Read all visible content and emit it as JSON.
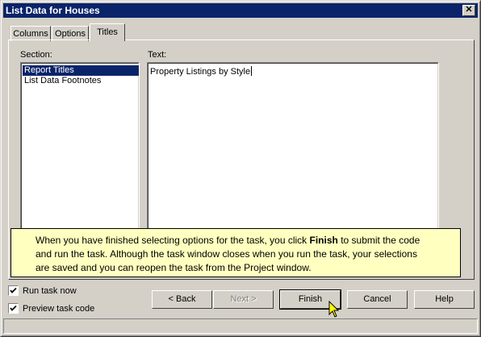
{
  "window": {
    "title": "List Data for Houses",
    "close_icon": "close-icon"
  },
  "tabs": [
    {
      "label": "Columns",
      "active": false
    },
    {
      "label": "Options",
      "active": false
    },
    {
      "label": "Titles",
      "active": true
    }
  ],
  "section": {
    "label": "Section:",
    "items": [
      {
        "label": "Report Titles",
        "selected": true
      },
      {
        "label": "List Data Footnotes",
        "selected": false
      }
    ]
  },
  "text_field": {
    "label": "Text:",
    "value": "Property Listings by Style"
  },
  "tip": {
    "line1_before": "When you have finished selecting options for the task, you click ",
    "line1_bold": "Finish",
    "line1_after": " to submit the code",
    "line2": "and run the task.  Although the task window closes when you run the task, your selections",
    "line3": "are saved and you can reopen the task from the Project window."
  },
  "options": {
    "run_task_now": {
      "label": "Run task now",
      "checked": true
    },
    "preview_task_code": {
      "label": "Preview task code",
      "checked": true
    }
  },
  "buttons": {
    "back": {
      "label": "< Back",
      "enabled": true
    },
    "next": {
      "label": "Next >",
      "enabled": false
    },
    "finish": {
      "label": "Finish",
      "enabled": true
    },
    "cancel": {
      "label": "Cancel",
      "enabled": true
    },
    "help": {
      "label": "Help",
      "enabled": true
    }
  },
  "colors": {
    "titlebar": "#0a246a",
    "face": "#d4d0c8",
    "tip_background": "#ffffc0",
    "selection": "#0a246a"
  }
}
